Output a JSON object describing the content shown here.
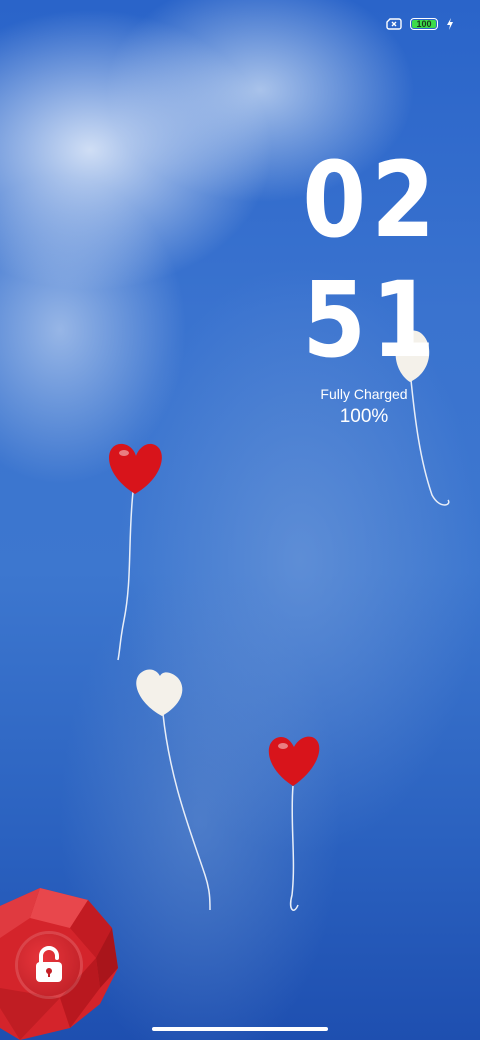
{
  "status_bar": {
    "battery_level": "100",
    "sim_icon": "no-sim-icon",
    "charging_icon": "bolt-icon",
    "battery_color": "#3ddc4a"
  },
  "clock": {
    "hours": "02",
    "minutes": "51"
  },
  "charging": {
    "status": "Fully Charged",
    "percent": "100%"
  },
  "unlock": {
    "icon": "unlock-icon",
    "color": "#d4242b"
  }
}
